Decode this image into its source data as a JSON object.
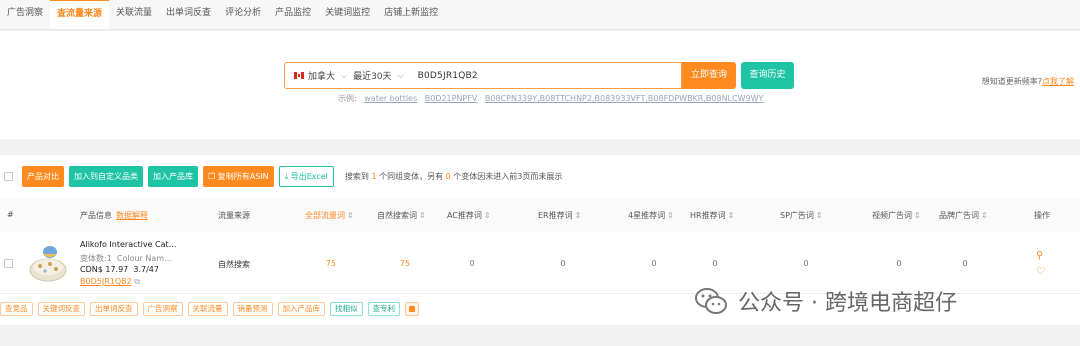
{
  "nav": {
    "tabs": [
      "广告洞察",
      "查流量来源",
      "关联流量",
      "出单词反查",
      "评论分析",
      "产品监控",
      "关键词监控",
      "店铺上新监控"
    ],
    "active_index": 1
  },
  "search": {
    "country": "加拿大",
    "period": "最近30天",
    "query": "B0D5JR1QB2",
    "query_button": "立即查询",
    "history_button": "查询历史",
    "examples_label": "示例:",
    "examples": [
      "water bottles",
      "B0D21PNPFV",
      "B08CPN339Y,B08TTCHNP2,B083933VFT,B08FDPWBKR,B08NLCW9WY"
    ],
    "freq_text": "想知道更新频率?",
    "freq_link": "点我了解"
  },
  "toolbar": {
    "compare": "产品对比",
    "add_category": "加入到自定义品类",
    "add_library": "加入产品库",
    "copy_asin": "复制所有ASIN",
    "export": "导出Excel",
    "summary_prefix": "搜索到",
    "summary_count1": "1",
    "summary_mid": "个同组变体，另有",
    "summary_count2": "0",
    "summary_suffix": "个变体因未进入前3页而未展示"
  },
  "table": {
    "headers": {
      "num": "#",
      "product": "产品信息",
      "data_explain": "数据解释",
      "source": "流量来源",
      "all": "全部流量词",
      "natural": "自然搜索词",
      "ac": "AC推荐词",
      "er": "ER推荐词",
      "star4": "4星推荐词",
      "hr": "HR推荐词",
      "sp": "SP广告词",
      "video": "视频广告词",
      "brand": "品牌广告词",
      "ops": "操作"
    },
    "row": {
      "name": "Alikofo Interactive Cat…",
      "variants": "变体数:1",
      "variant_attr": "Colour Nam…",
      "price": "CDN$ 17.97",
      "rating": "3.7/47",
      "asin": "B0D5JR1QB2",
      "source": "自然搜索",
      "all": "75",
      "natural": "75",
      "ac": "0",
      "er": "0",
      "star4": "0",
      "hr": "0",
      "sp": "0",
      "video": "0",
      "brand": "0"
    },
    "tags": [
      "查竞品",
      "关键词反查",
      "出单词反查",
      "广告洞察",
      "关联流量",
      "销量预测",
      "加入产品库",
      "找相似",
      "查专利"
    ]
  },
  "watermark": "公众号 · 跨境电商超仔",
  "colors": {
    "accent": "#ff8a1f",
    "teal": "#1ec4a4"
  }
}
